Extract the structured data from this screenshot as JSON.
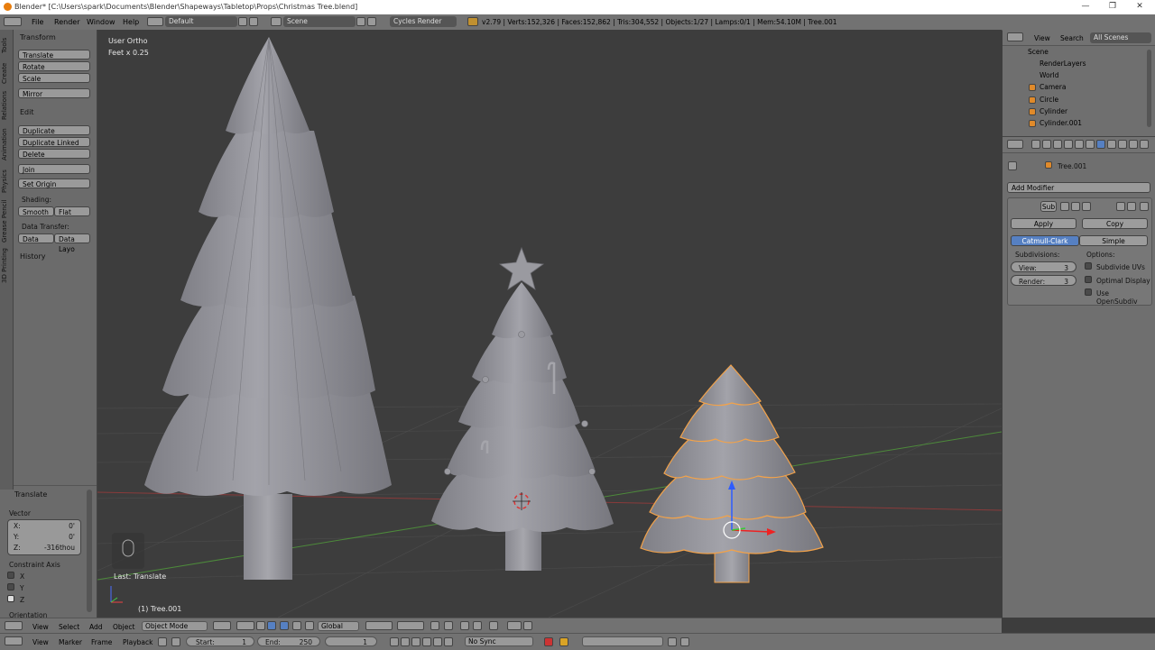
{
  "window": {
    "title": "Blender* [C:\\Users\\spark\\Documents\\Blender\\Shapeways\\Tabletop\\Props\\Christmas Tree.blend]",
    "minimize": "—",
    "maximize": "❐",
    "close": "✕"
  },
  "infobar": {
    "menus": [
      "File",
      "Render",
      "Window",
      "Help"
    ],
    "layout": "Default",
    "scene": "Scene",
    "engine": "Cycles Render",
    "stats": "v2.79 | Verts:152,326 | Faces:152,862 | Tris:304,552 | Objects:1/27 | Lamps:0/1 | Mem:54.10M | Tree.001"
  },
  "tool_tabs": [
    "Tools",
    "Create",
    "Relations",
    "Animation",
    "Physics",
    "Grease Pencil",
    "3D Printing"
  ],
  "tools": {
    "transform_header": "Transform",
    "transform_buttons": [
      "Translate",
      "Rotate",
      "Scale"
    ],
    "mirror": "Mirror",
    "edit_header": "Edit",
    "edit_buttons": [
      "Duplicate",
      "Duplicate Linked",
      "Delete"
    ],
    "join": "Join",
    "set_origin": "Set Origin",
    "shading_label": "Shading:",
    "smooth": "Smooth",
    "flat": "Flat",
    "data_transfer_label": "Data Transfer:",
    "data": "Data",
    "data_layo": "Data Layo",
    "history_header": "History"
  },
  "operator": {
    "header": "Translate",
    "vector_label": "Vector",
    "x_label": "X:",
    "x_value": "0'",
    "y_label": "Y:",
    "y_value": "0'",
    "z_label": "Z:",
    "z_value": "-316thou",
    "constraint_label": "Constraint Axis",
    "axis_x": "X",
    "axis_y": "Y",
    "axis_z": "Z",
    "orientation_label": "Orientation"
  },
  "viewport": {
    "view_name": "User Ortho",
    "scale": "Feet x 0.25",
    "last_op": "Last: Translate",
    "active_object": "(1) Tree.001",
    "grid_color": "#4a4a4a",
    "selection_color": "#f2a24a"
  },
  "outliner": {
    "tabs": [
      "View",
      "Search",
      "All Scenes"
    ],
    "rows": [
      "Scene",
      "RenderLayers",
      "World",
      "Camera",
      "Circle",
      "Cylinder",
      "Cylinder.001"
    ]
  },
  "properties": {
    "object_name": "Tree.001",
    "add_modifier": "Add Modifier",
    "modifier_name": "Sub",
    "apply": "Apply",
    "copy": "Copy",
    "catmull": "Catmull-Clark",
    "simple": "Simple",
    "subdivisions_label": "Subdivisions:",
    "options_label": "Options:",
    "view_label": "View:",
    "view_value": "3",
    "render_label": "Render:",
    "render_value": "3",
    "subdivide_uvs": "Subdivide UVs",
    "optimal_display": "Optimal Display",
    "use_opensubdiv": "Use OpenSubdiv",
    "accent": "#5680c2"
  },
  "view_header": {
    "view": "View",
    "select": "Select",
    "add": "Add",
    "object": "Object",
    "mode": "Object Mode",
    "orientation": "Global"
  },
  "timeline": {
    "view": "View",
    "marker": "Marker",
    "frame": "Frame",
    "playback": "Playback",
    "start_label": "Start:",
    "start_value": "1",
    "end_label": "End:",
    "end_value": "250",
    "current": "1",
    "sync": "No Sync"
  }
}
